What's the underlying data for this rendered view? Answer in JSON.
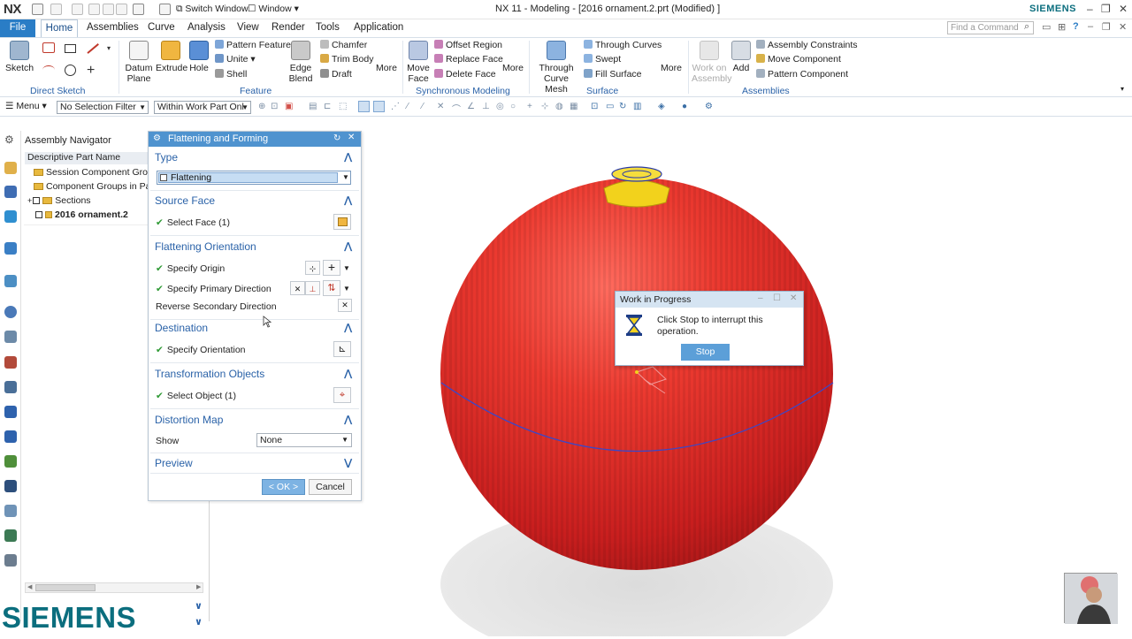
{
  "app": {
    "logo": "NX",
    "window_title": "NX 11 - Modeling - [2016 ornament.2.prt (Modified) ]",
    "brand": "SIEMENS",
    "switch_window": "Switch Window",
    "window_menu": "Window"
  },
  "menu": {
    "file": "File",
    "tabs": [
      "Home",
      "Assemblies",
      "Curve",
      "Analysis",
      "View",
      "Render",
      "Tools",
      "Application"
    ]
  },
  "search": {
    "placeholder": "Find a Command"
  },
  "ribbon": {
    "direct_sketch": {
      "sketch": "Sketch",
      "group": "Direct Sketch"
    },
    "feature": {
      "datum_plane": "Datum Plane",
      "extrude": "Extrude",
      "hole": "Hole",
      "pattern_feature": "Pattern Feature",
      "unite": "Unite",
      "shell": "Shell",
      "edge_blend": "Edge Blend",
      "chamfer": "Chamfer",
      "trim_body": "Trim Body",
      "draft": "Draft",
      "more": "More",
      "group": "Feature"
    },
    "synchronous": {
      "move_face": "Move Face",
      "offset_region": "Offset Region",
      "replace_face": "Replace Face",
      "delete_face": "Delete Face",
      "more": "More",
      "group": "Synchronous Modeling"
    },
    "surface": {
      "through_curve_mesh": "Through Curve Mesh",
      "through_curves": "Through Curves",
      "swept": "Swept",
      "fill_surface": "Fill Surface",
      "more": "More",
      "group": "Surface"
    },
    "assemblies": {
      "work_on_assembly": "Work on Assembly",
      "add": "Add",
      "assembly_constraints": "Assembly Constraints",
      "move_component": "Move Component",
      "pattern_component": "Pattern Component",
      "group": "Assemblies"
    }
  },
  "toolbar": {
    "menu": "Menu",
    "selection_filter": "No Selection Filter",
    "scope": "Within Work Part Onl"
  },
  "navigator": {
    "title": "Assembly Navigator",
    "column_header": "Descriptive Part Name",
    "rows": [
      "Session Component Group",
      "Component Groups in Part",
      "Sections",
      "2016 ornament.2"
    ]
  },
  "dialog": {
    "title": "Flattening and Forming",
    "type_section": "Type",
    "type_value": "Flattening",
    "source_face_section": "Source Face",
    "select_face": "Select Face (1)",
    "orientation_section": "Flattening Orientation",
    "specify_origin": "Specify Origin",
    "specify_primary_direction": "Specify Primary Direction",
    "reverse_secondary_direction": "Reverse Secondary Direction",
    "destination_section": "Destination",
    "specify_orientation": "Specify Orientation",
    "transformation_section": "Transformation Objects",
    "select_object": "Select Object (1)",
    "distortion_section": "Distortion Map",
    "show_label": "Show",
    "show_value": "None",
    "preview_section": "Preview",
    "ok": "< OK >",
    "cancel": "Cancel"
  },
  "progress_dialog": {
    "title": "Work in Progress",
    "message": "Click Stop to interrupt this operation.",
    "stop": "Stop"
  },
  "footer_logo": "SIEMENS",
  "colors": {
    "accent": "#2a7dc6",
    "dialog_title": "#4f93cf",
    "section_text": "#2a62a8",
    "sphere_red": "#e42a2a",
    "cap_yellow": "#f2d21c",
    "siemens_teal": "#0b6e7e"
  }
}
